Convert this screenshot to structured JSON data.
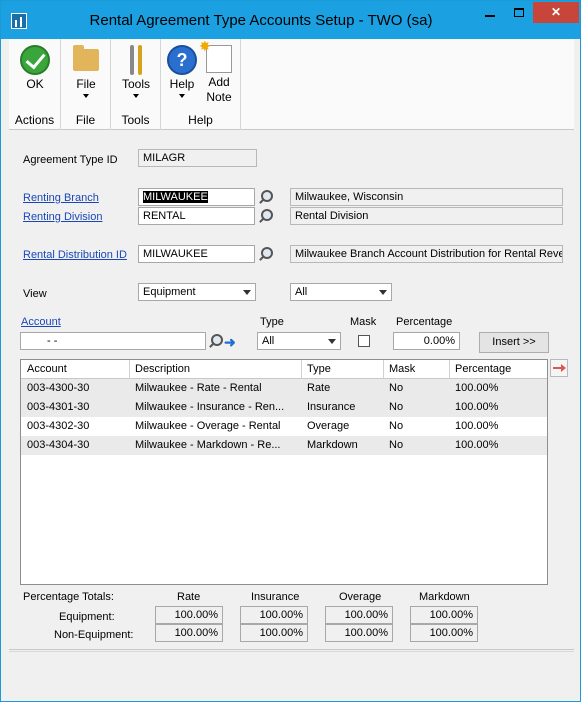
{
  "window": {
    "title": "Rental Agreement Type Accounts Setup  -  TWO (sa)",
    "controls": {
      "minimize": "minimize",
      "maximize": "maximize",
      "close": "✕"
    }
  },
  "ribbon": {
    "groups": [
      {
        "label": "Actions",
        "buttons": [
          {
            "label": "OK",
            "icon": "ok-icon"
          }
        ]
      },
      {
        "label": "File",
        "buttons": [
          {
            "label": "File",
            "icon": "folder-icon"
          }
        ]
      },
      {
        "label": "Tools",
        "buttons": [
          {
            "label": "Tools",
            "icon": "tools-icon"
          }
        ]
      },
      {
        "label": "Help",
        "buttons": [
          {
            "label": "Help",
            "icon": "help-icon"
          },
          {
            "label_line1": "Add",
            "label_line2": "Note",
            "icon": "add-note-icon"
          }
        ]
      }
    ]
  },
  "form": {
    "agreement_type_id_label": "Agreement Type ID",
    "agreement_type_id_value": "MILAGR",
    "renting_branch_label": "Renting Branch",
    "renting_branch_value": "MILWAUKEE",
    "renting_branch_desc": "Milwaukee, Wisconsin",
    "renting_division_label": "Renting Division",
    "renting_division_value": "RENTAL",
    "renting_division_desc": "Rental Division",
    "rental_dist_label": "Rental Distribution ID",
    "rental_dist_value": "MILWAUKEE",
    "rental_dist_desc": "Milwaukee Branch Account Distribution for Rental Reve",
    "view_label": "View",
    "view_value": "Equipment",
    "view_filter_value": "All",
    "account_label": "Account",
    "account_value": "-          -",
    "type_label": "Type",
    "type_value": "All",
    "mask_label": "Mask",
    "percentage_label": "Percentage",
    "percentage_value": "0.00%",
    "insert_button": "Insert >>"
  },
  "grid": {
    "columns": [
      "Account",
      "Description",
      "Type",
      "Mask",
      "Percentage"
    ],
    "rows": [
      {
        "account": "003-4300-30",
        "description": "Milwaukee - Rate - Rental",
        "type": "Rate",
        "mask": "No",
        "percentage": "100.00%"
      },
      {
        "account": "003-4301-30",
        "description": "Milwaukee - Insurance - Ren...",
        "type": "Insurance",
        "mask": "No",
        "percentage": "100.00%"
      },
      {
        "account": "003-4302-30",
        "description": "Milwaukee - Overage - Rental",
        "type": "Overage",
        "mask": "No",
        "percentage": "100.00%"
      },
      {
        "account": "003-4304-30",
        "description": "Milwaukee - Markdown - Re...",
        "type": "Markdown",
        "mask": "No",
        "percentage": "100.00%"
      }
    ]
  },
  "totals": {
    "label": "Percentage Totals:",
    "col_rate": "Rate",
    "col_insurance": "Insurance",
    "col_overage": "Overage",
    "col_markdown": "Markdown",
    "equipment_label": "Equipment:",
    "non_equipment_label": "Non-Equipment:",
    "equipment": [
      "100.00%",
      "100.00%",
      "100.00%",
      "100.00%"
    ],
    "non_equipment": [
      "100.00%",
      "100.00%",
      "100.00%",
      "100.00%"
    ]
  }
}
